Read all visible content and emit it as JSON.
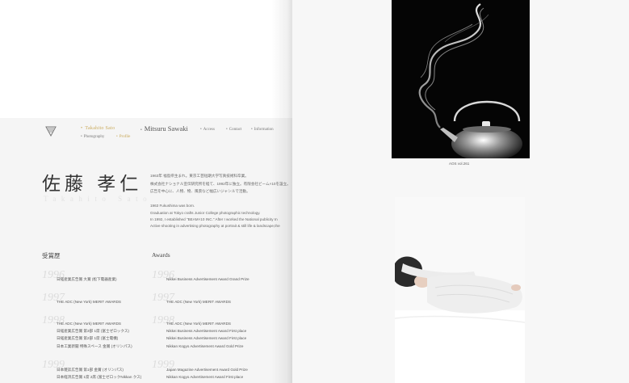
{
  "nav": {
    "photographer1": "Takahito Sato",
    "photographer2": "Mitsuru Sawaki",
    "access": "Access",
    "contact": "Contact",
    "information": "Information",
    "photography": "Photography",
    "profile": "Profile"
  },
  "colors": {
    "accent": "#c9a95a"
  },
  "profile": {
    "name_jp": "佐藤 孝仁",
    "name_en": "Takahito Sato",
    "bio_jp": [
      "1963年 福島県生まれ。東京工芸短期大学写真技術科卒業。",
      "株式会社ナショナル宣伝研究所を経て、1992年に独立。有限会社ビーム×10を設立。",
      "広告を中心に、人物、物、風景など幅広いジャンルで活動。"
    ],
    "bio_en": [
      "1963 Fukushima was born.",
      "Graduation at Tokyo crafts Junior College photographic technology.",
      "In 1992, I established \"BEAM×10 INC.\" After I worked the National publicity In",
      "Active shooting in advertising photography at portrait & still life & landscape,the"
    ]
  },
  "awards": {
    "heading_jp": "受賞歴",
    "heading_en": "Awards",
    "rows": [
      {
        "year_jp": "1996",
        "year_en": "1996",
        "jp": [
          "日経産業広告賞 大賞 (松下電器産業)"
        ],
        "en": [
          "Nikkei Business Advertisement Award Grand Prize"
        ]
      },
      {
        "year_jp": "1997",
        "year_en": "1997",
        "jp": [
          "THE ADC (New York) MERIT AWARDS"
        ],
        "en": [
          "THE ADC (New York) MERIT AWARDS"
        ]
      },
      {
        "year_jp": "1998",
        "year_en": "1998",
        "jp": [
          "THE ADC (New York) MERIT AWARDS",
          "日経産業広告賞 第3部 1席 (富士ゼロックス)",
          "日経産業広告賞 第2部 1席 (富士電機)",
          "日本工業新聞 特殊スペース 金賞 (オリンパス)"
        ],
        "en": [
          "THE ADC (New York) MERIT AWARDS",
          "Nikkei Business Advertisement Award First place",
          "Nikkei Business Advertisement Award First place",
          "Nikkan Kogyo Advertisement Award Gold Prize"
        ]
      },
      {
        "year_jp": "1999",
        "year_en": "1999",
        "jp": [
          "日本雑誌広告賞 第1部 金賞 (オリンパス)",
          "日本経済広告賞 1席 2席 (富士ゼロックNikkan クス)"
        ],
        "en": [
          "Japan Magazine Advertisement Award Gold Prize",
          "Nikkan Kogyo Advertisement Award First place"
        ]
      }
    ]
  },
  "gallery": {
    "caption1": "AOS vol.261"
  }
}
